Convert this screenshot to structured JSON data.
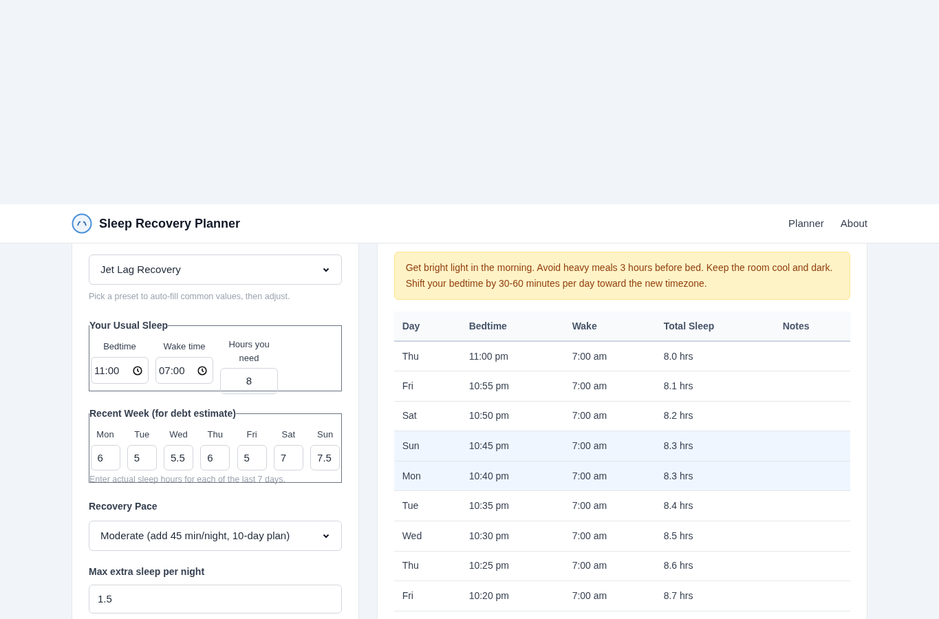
{
  "header": {
    "title": "Sleep Recovery Planner",
    "nav": [
      {
        "label": "Planner"
      },
      {
        "label": "About"
      }
    ]
  },
  "form": {
    "preset": {
      "value": "Jet Lag Recovery",
      "hint": "Pick a preset to auto-fill common values, then adjust."
    },
    "usual_sleep": {
      "legend": "Your Usual Sleep",
      "bedtime": {
        "label": "Bedtime",
        "value": "11:00"
      },
      "wake": {
        "label": "Wake time",
        "value": "07:00"
      },
      "hours": {
        "label": "Hours you need",
        "value": "8"
      }
    },
    "recent_week": {
      "legend": "Recent Week (for debt estimate)",
      "days": [
        {
          "label": "Mon",
          "value": "6"
        },
        {
          "label": "Tue",
          "value": "5"
        },
        {
          "label": "Wed",
          "value": "5.5"
        },
        {
          "label": "Thu",
          "value": "6"
        },
        {
          "label": "Fri",
          "value": "5"
        },
        {
          "label": "Sat",
          "value": "7"
        },
        {
          "label": "Sun",
          "value": "7.5"
        }
      ],
      "hint": "Enter actual sleep hours for each of the last 7 days."
    },
    "pace": {
      "label": "Recovery Pace",
      "value": "Moderate (add 45 min/night, 10-day plan)"
    },
    "max_extra": {
      "label": "Max extra sleep per night",
      "value": "1.5"
    }
  },
  "tip": "Get bright light in the morning. Avoid heavy meals 3 hours before bed. Keep the room cool and dark. Shift your bedtime by 30-60 minutes per day toward the new timezone.",
  "table": {
    "columns": [
      "Day",
      "Bedtime",
      "Wake",
      "Total Sleep",
      "Notes"
    ],
    "rows": [
      {
        "day": "Thu",
        "bedtime": "11:00 pm",
        "wake": "7:00 am",
        "total": "8.0 hrs",
        "highlighted": false
      },
      {
        "day": "Fri",
        "bedtime": "10:55 pm",
        "wake": "7:00 am",
        "total": "8.1 hrs",
        "highlighted": false
      },
      {
        "day": "Sat",
        "bedtime": "10:50 pm",
        "wake": "7:00 am",
        "total": "8.2 hrs",
        "highlighted": false
      },
      {
        "day": "Sun",
        "bedtime": "10:45 pm",
        "wake": "7:00 am",
        "total": "8.3 hrs",
        "highlighted": true
      },
      {
        "day": "Mon",
        "bedtime": "10:40 pm",
        "wake": "7:00 am",
        "total": "8.3 hrs",
        "highlighted": true
      },
      {
        "day": "Tue",
        "bedtime": "10:35 pm",
        "wake": "7:00 am",
        "total": "8.4 hrs",
        "highlighted": false
      },
      {
        "day": "Wed",
        "bedtime": "10:30 pm",
        "wake": "7:00 am",
        "total": "8.5 hrs",
        "highlighted": false
      },
      {
        "day": "Thu",
        "bedtime": "10:25 pm",
        "wake": "7:00 am",
        "total": "8.6 hrs",
        "highlighted": false
      },
      {
        "day": "Fri",
        "bedtime": "10:20 pm",
        "wake": "7:00 am",
        "total": "8.7 hrs",
        "highlighted": false
      }
    ]
  }
}
